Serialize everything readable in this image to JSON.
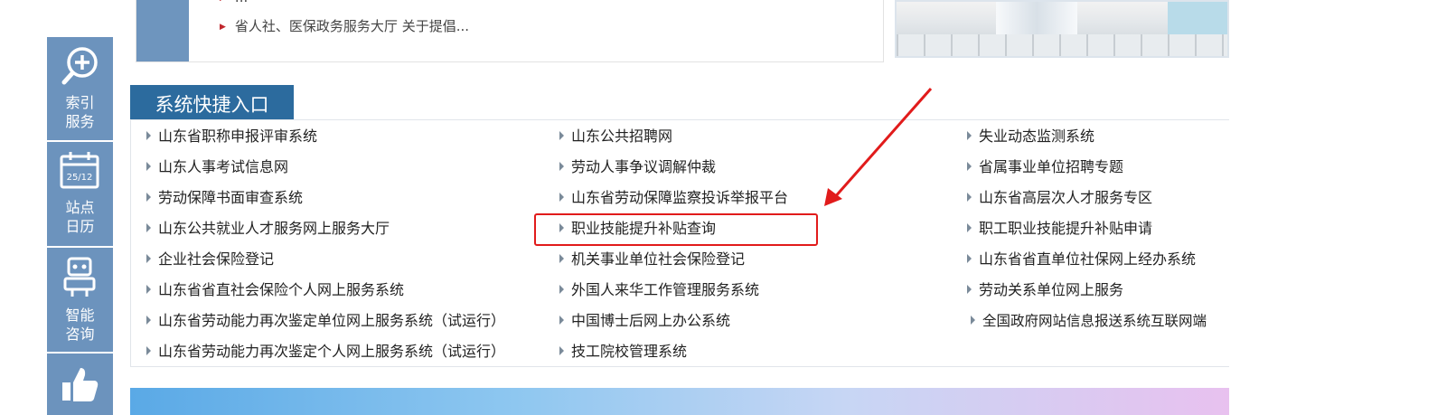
{
  "news": {
    "line_top": "...",
    "line2": "省人社、医保政务服务大厅 关于提倡..."
  },
  "sidebar": {
    "items": [
      {
        "label": "索引\n服务",
        "icon": "zoom-in-icon"
      },
      {
        "label": "站点\n日历",
        "icon": "calendar-icon",
        "date": "25/12"
      },
      {
        "label": "智能\n咨询",
        "icon": "robot-icon"
      },
      {
        "label": "",
        "icon": "thumbs-up-icon"
      }
    ]
  },
  "section": {
    "title": "系统快捷入口",
    "columns": [
      [
        "山东省职称申报评审系统",
        "山东人事考试信息网",
        "劳动保障书面审查系统",
        "山东公共就业人才服务网上服务大厅",
        "企业社会保险登记",
        "山东省省直社会保险个人网上服务系统",
        "山东省劳动能力再次鉴定单位网上服务系统（试运行）",
        "山东省劳动能力再次鉴定个人网上服务系统（试运行）"
      ],
      [
        "山东公共招聘网",
        "劳动人事争议调解仲裁",
        "山东省劳动保障监察投诉举报平台",
        "职业技能提升补贴查询",
        "机关事业单位社会保险登记",
        "外国人来华工作管理服务系统",
        "中国博士后网上办公系统",
        "技工院校管理系统"
      ],
      [
        "失业动态监测系统",
        "省属事业单位招聘专题",
        "山东省高层次人才服务专区",
        "职工职业技能提升补贴申请",
        "山东省省直单位社保网上经办系统",
        "劳动关系单位网上服务",
        "全国政府网站信息报送系统互联网端"
      ]
    ]
  },
  "annotation": {
    "highlighted_item": "职业技能提升补贴查询",
    "color": "#e11b1b"
  },
  "colors": {
    "sidebar": "#6c93bd",
    "tab": "#2c6b9e"
  }
}
